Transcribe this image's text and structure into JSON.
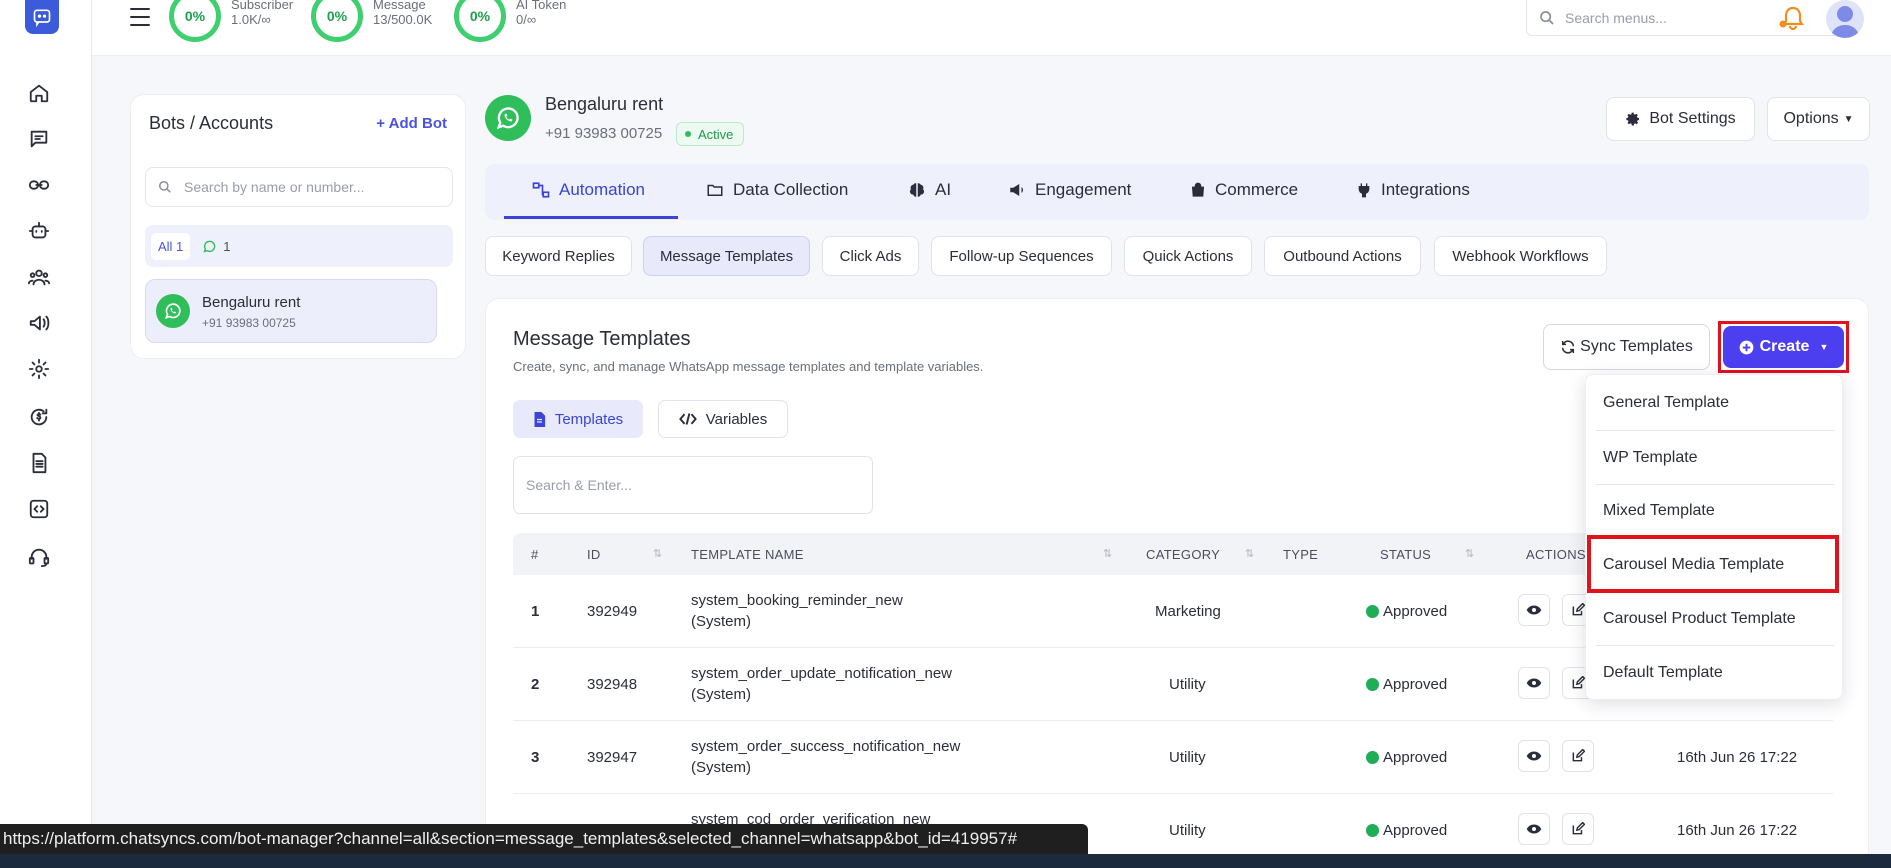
{
  "topbar": {
    "stats": [
      {
        "percent": "0%",
        "label": "Subscriber",
        "value": "1.0K/∞"
      },
      {
        "percent": "0%",
        "label": "Message",
        "value": "13/500.0K"
      },
      {
        "percent": "0%",
        "label": "AI Token",
        "value": "0/∞"
      }
    ],
    "search_placeholder": "Search menus..."
  },
  "bots_panel": {
    "title": "Bots / Accounts",
    "add_label": "Add Bot",
    "search_placeholder": "Search by name or number...",
    "filter_all": "All 1",
    "filter_whatsapp_count": "1",
    "bots": [
      {
        "name": "Bengaluru rent",
        "phone": "+91 93983 00725"
      }
    ]
  },
  "bot_header": {
    "name": "Bengaluru rent",
    "phone": "+91 93983 00725",
    "status": "Active",
    "settings_label": "Bot Settings",
    "options_label": "Options"
  },
  "main_tabs": [
    "Automation",
    "Data Collection",
    "AI",
    "Engagement",
    "Commerce",
    "Integrations"
  ],
  "sub_tabs": [
    "Keyword Replies",
    "Message Templates",
    "Click Ads",
    "Follow-up Sequences",
    "Quick Actions",
    "Outbound Actions",
    "Webhook Workflows"
  ],
  "content": {
    "title": "Message Templates",
    "subtitle": "Create, sync, and manage WhatsApp message templates and template variables.",
    "sync_label": "Sync Templates",
    "create_label": "Create",
    "seg_templates": "Templates",
    "seg_variables": "Variables",
    "search_placeholder": "Search & Enter...",
    "columns": {
      "num": "#",
      "id": "ID",
      "name": "TEMPLATE NAME",
      "category": "CATEGORY",
      "type": "TYPE",
      "status": "STATUS",
      "actions": "ACTIONS"
    },
    "rows": [
      {
        "num": "1",
        "id": "392949",
        "name": "system_booking_reminder_new",
        "tag": "(System)",
        "category": "Marketing",
        "status": "Approved",
        "date": ""
      },
      {
        "num": "2",
        "id": "392948",
        "name": "system_order_update_notification_new",
        "tag": "(System)",
        "category": "Utility",
        "status": "Approved",
        "date": ""
      },
      {
        "num": "3",
        "id": "392947",
        "name": "system_order_success_notification_new",
        "tag": "(System)",
        "category": "Utility",
        "status": "Approved",
        "date": "16th Jun 26 17:22"
      },
      {
        "num": "",
        "id": "",
        "name": "system_cod_order_verification_new",
        "tag": "",
        "category": "Utility",
        "status": "Approved",
        "date": "16th Jun 26 17:22"
      }
    ]
  },
  "dropdown": {
    "items": [
      "General Template",
      "WP Template",
      "Mixed Template",
      "Carousel Media Template",
      "Carousel Product Template",
      "Default Template"
    ]
  },
  "status_url": "https://platform.chatsyncs.com/bot-manager?channel=all&section=message_templates&selected_channel=whatsapp&bot_id=419957#",
  "colors": {
    "accent": "#4c3ff0",
    "success": "#1fae55",
    "highlight": "#e0121c"
  }
}
